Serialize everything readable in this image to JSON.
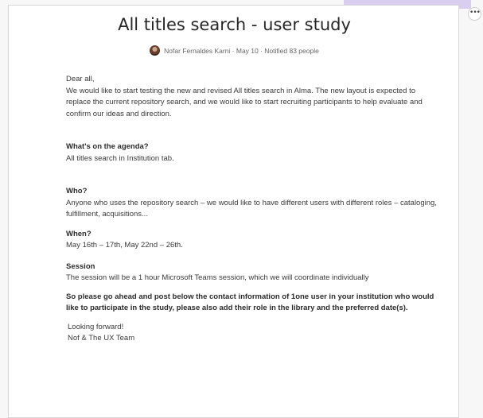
{
  "post": {
    "title": "All titles search - user study",
    "meta": "Nofar Fernaldes Karni · May 10 · Notified 83 people",
    "more_icon": "•••",
    "greeting": "Dear all,",
    "intro": "We would like to start testing the new and revised All titles search in Alma. The new layout is expected to replace the current repository search, and we would like to start recruiting participants to help evaluate and confirm our ideas and direction.",
    "agenda_heading": "What's on the agenda?",
    "agenda_text": "All titles search in Institution tab.",
    "who_heading": "Who?",
    "who_text": "Anyone who uses the repository search – we would like to have different users with different roles – cataloging, fulfillment, acquisitions...",
    "when_heading": "When?",
    "when_text": "May 16th – 17th, May 22nd – 26th.",
    "session_heading": "Session",
    "session_text": "The session will be a 1 hour Microsoft Teams session, which we will coordinate individually",
    "request_text": "So please go ahead and post below the contact information of 1one user in your institution who would like to participate in the study, please also add their role in the library and the preferred date(s).",
    "closing": "Looking forward!",
    "signature": "Nof & The UX Team"
  }
}
